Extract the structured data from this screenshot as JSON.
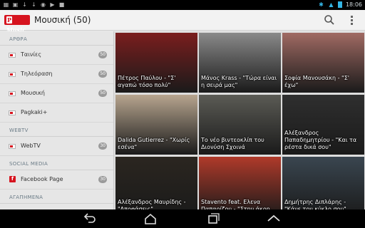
{
  "statusbar": {
    "time": "18:06"
  },
  "app": {
    "logo_letter": "P",
    "logo_text": "Music",
    "title": "Μουσική (50)"
  },
  "sidebar": {
    "sections": [
      {
        "header": "ΑΡΘΡΑ",
        "items": [
          {
            "label": "Ταινίες",
            "badge": "50"
          },
          {
            "label": "Τηλεόραση",
            "badge": "50"
          },
          {
            "label": "Μουσική",
            "badge": "50"
          },
          {
            "label": "Pagkaki+",
            "badge": ""
          }
        ]
      },
      {
        "header": "WEBTV",
        "items": [
          {
            "label": "WebTV",
            "badge": "30"
          }
        ]
      },
      {
        "header": "SOCIAL MEDIA",
        "items": [
          {
            "label": "Facebook Page",
            "badge": "30"
          }
        ]
      },
      {
        "header": "ΑΓΑΠΗΜΕΝΑ",
        "items": []
      }
    ]
  },
  "tiles": [
    {
      "label": "Πέτρος Παύλου - \"Σ' αγαπώ τόσο πολύ\"",
      "color": "#7a1e1e"
    },
    {
      "label": "Μάνος Krass - \"Τώρα είναι η σειρά μας\"",
      "color": "#8a8a8a"
    },
    {
      "label": "Σοφία Μανουσάκη - \"Σ' έχω\"",
      "color": "#a06a63"
    },
    {
      "label": "Dalida Gutierrez - \"Χωρίς εσένα\"",
      "color": "#b7a58f"
    },
    {
      "label": "Το νέο βιντεοκλίπ του Διονύση Σχοινά",
      "color": "#5b5b55"
    },
    {
      "label": "Αλέξανδρος Παπαδημητρίου - \"Και τα ρέστα δικά σου\"",
      "color": "#2f2f2f"
    },
    {
      "label": "Αλέξανδρος Μαυρίδης - \"Αποφάσεις\"",
      "color": "#2b2620"
    },
    {
      "label": "Stavento feat. Ελενα Παπαρίζου - \"Στην άκρη",
      "color": "#b03a2a"
    },
    {
      "label": "Δημήτρης Διπλάρης - \"Κάνε τον κύκλο σου\"",
      "color": "#3a4650"
    }
  ]
}
